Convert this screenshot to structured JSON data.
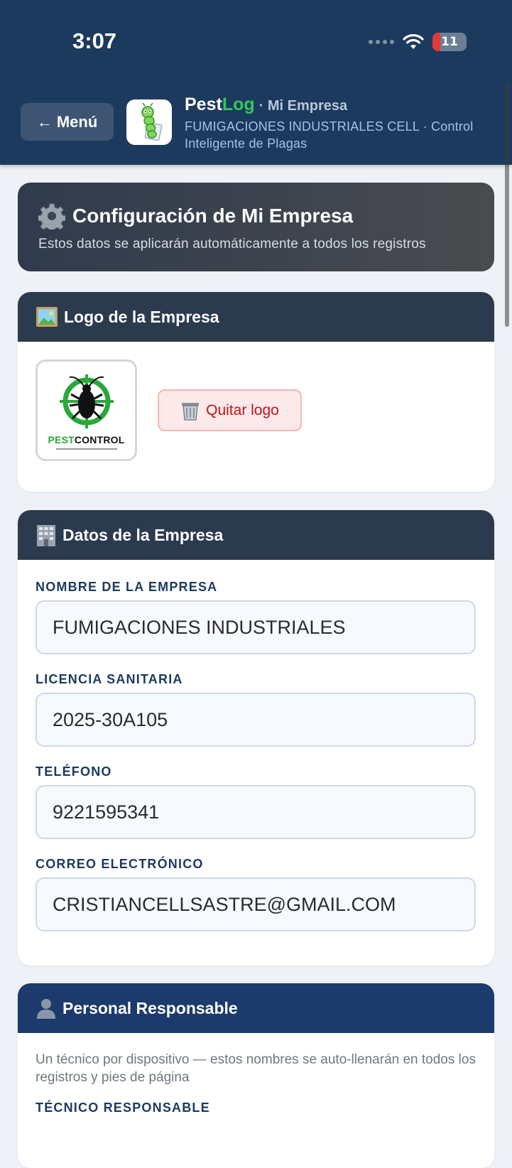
{
  "status": {
    "time": "3:07",
    "battery": "11",
    "battery_level": 0.11
  },
  "header": {
    "menu_label": "← Menú",
    "brand_pest": "Pest",
    "brand_log": "Log",
    "brand_suffix": "· Mi Empresa",
    "subtitle": "FUMIGACIONES INDUSTRIALES CELL · Control Inteligente de Plagas"
  },
  "hero": {
    "title": "Configuración de Mi Empresa",
    "subtitle": "Estos datos se aplicarán automáticamente a todos los registros"
  },
  "logo_section": {
    "title": "Logo de la Empresa",
    "logo_text_pest": "PEST",
    "logo_text_control": "CONTROL",
    "remove_label": "Quitar logo"
  },
  "company_section": {
    "title": "Datos de la Empresa",
    "fields": [
      {
        "label": "NOMBRE DE LA EMPRESA",
        "value": "FUMIGACIONES INDUSTRIALES"
      },
      {
        "label": "LICENCIA SANITARIA",
        "value": "2025-30A105"
      },
      {
        "label": "TELÉFONO",
        "value": "9221595341"
      },
      {
        "label": "CORREO ELECTRÓNICO",
        "value": "CRISTIANCELLSASTRE@GMAIL.COM"
      }
    ]
  },
  "staff_section": {
    "title": "Personal Responsable",
    "hint": "Un técnico por dispositivo — estos nombres se auto-llenarán en todos los registros y pies de página",
    "tech_label": "TÉCNICO RESPONSABLE"
  },
  "colors": {
    "header_bg": "#1c3a5e",
    "brand_green": "#34c759",
    "danger": "#c2131b",
    "card_head": "#2c3a4e",
    "card_head_blue": "#1c3a6b"
  },
  "icons": {
    "gear": "gear-icon",
    "picture": "picture-icon",
    "trash": "trash-icon",
    "building": "building-icon",
    "person": "person-icon"
  }
}
